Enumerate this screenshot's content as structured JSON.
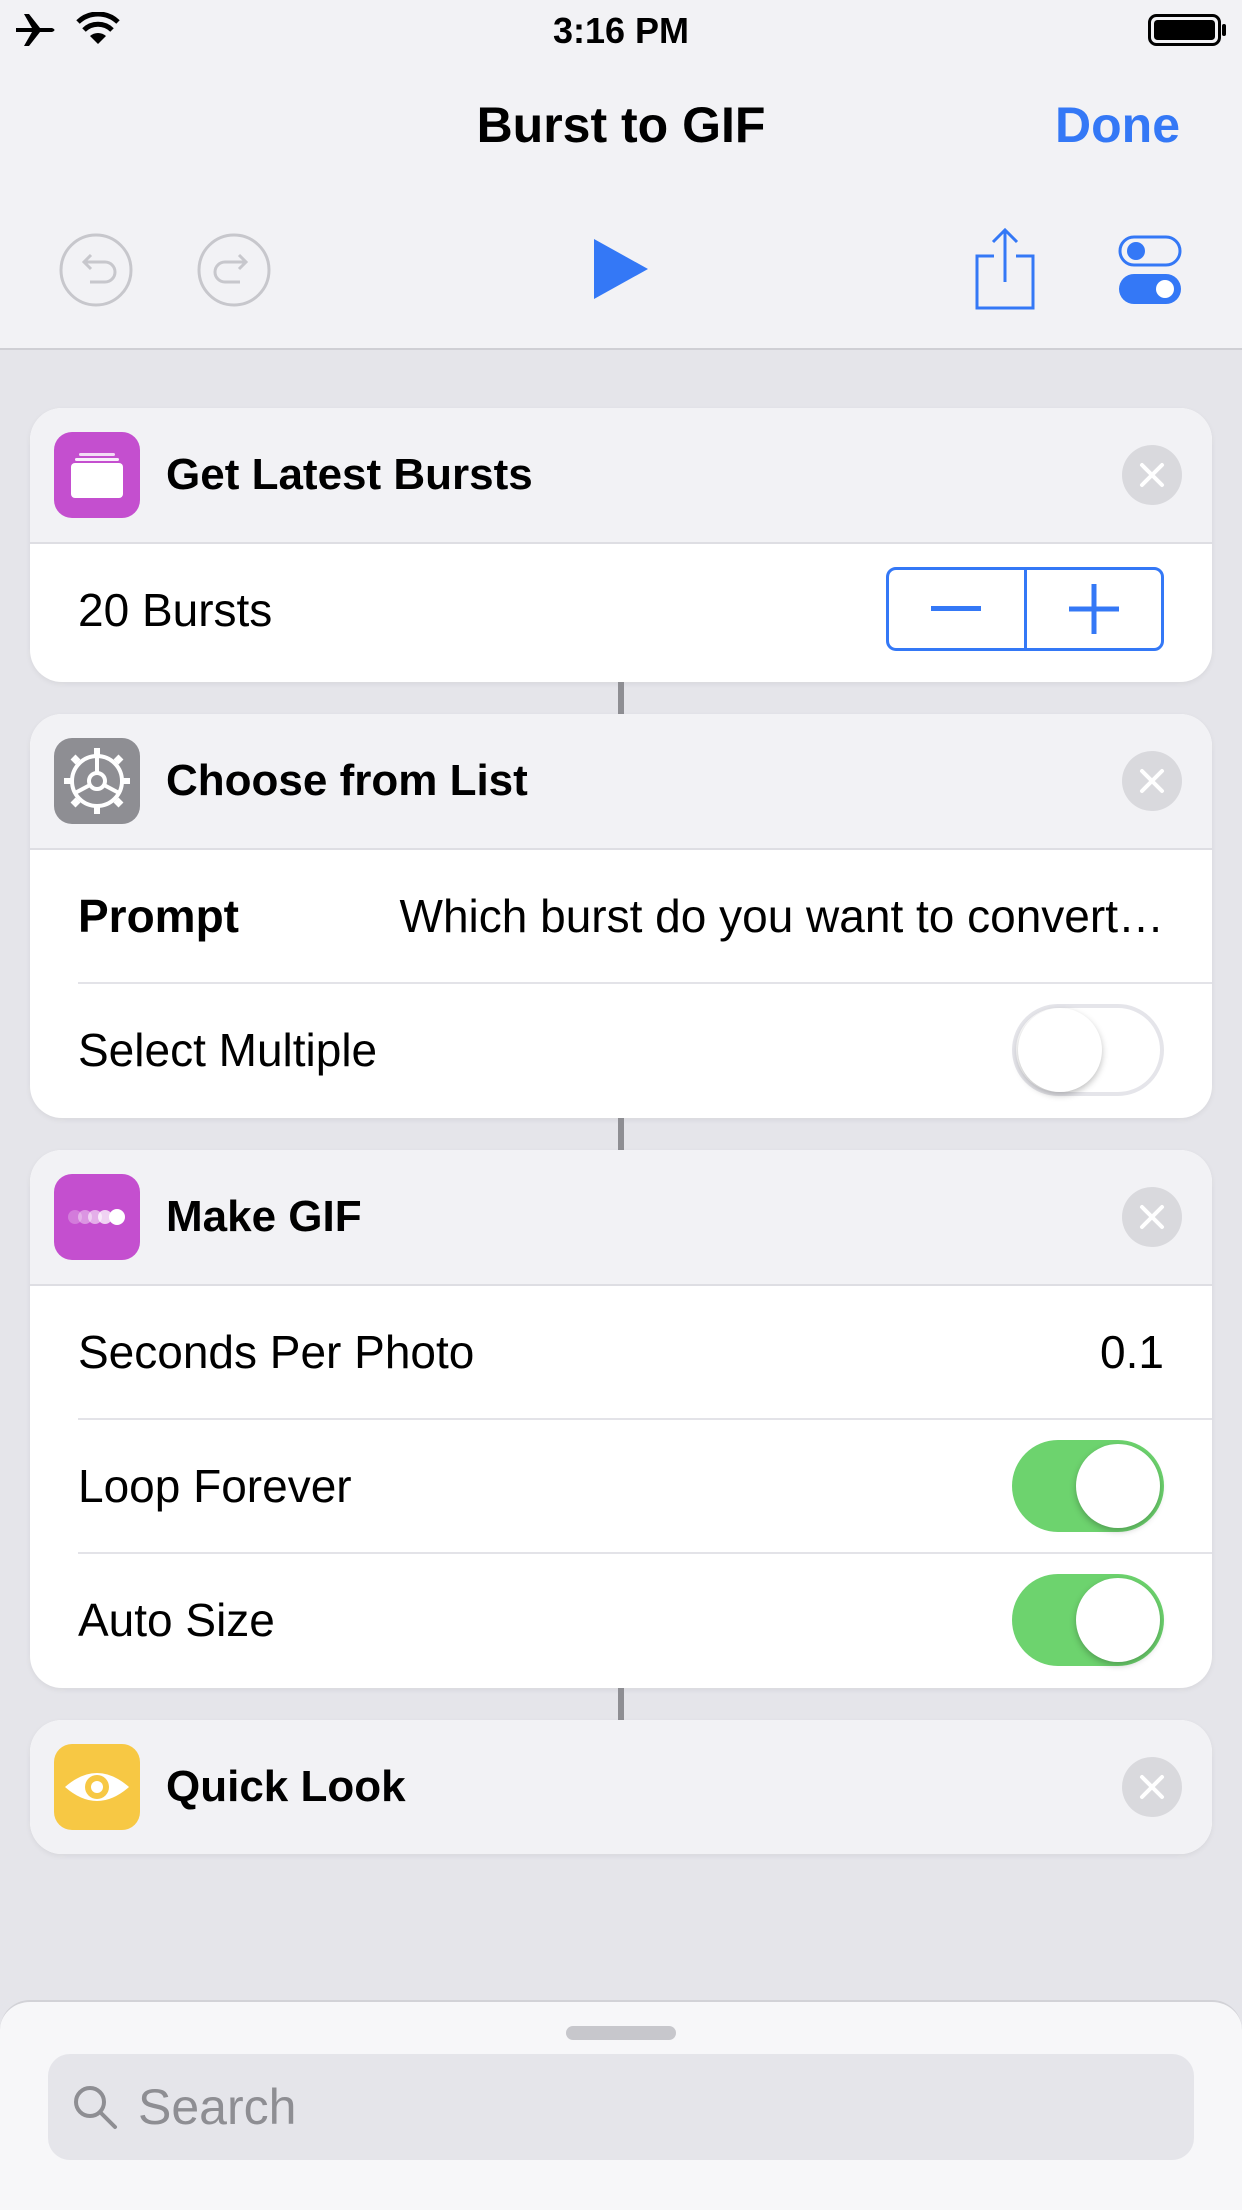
{
  "status_bar": {
    "time": "3:16 PM"
  },
  "nav": {
    "title": "Burst to GIF",
    "done_label": "Done"
  },
  "accent": "#3478f6",
  "actions": [
    {
      "title": "Get Latest Bursts",
      "icon": "photos-stack-icon",
      "icon_color": "#c44fcf",
      "count_label": "20 Bursts"
    },
    {
      "title": "Choose from List",
      "icon": "gear-icon",
      "icon_color": "#8e8e93",
      "prompt_label": "Prompt",
      "prompt_value": "Which burst do you want to convert…",
      "select_multiple_label": "Select Multiple",
      "select_multiple": false
    },
    {
      "title": "Make GIF",
      "icon": "gif-dots-icon",
      "icon_color": "#c44fcf",
      "seconds_label": "Seconds Per Photo",
      "seconds_value": "0.1",
      "loop_label": "Loop Forever",
      "loop": true,
      "autosize_label": "Auto Size",
      "autosize": true
    },
    {
      "title": "Quick Look",
      "icon": "eye-icon",
      "icon_color": "#f7c844"
    }
  ],
  "search": {
    "placeholder": "Search"
  }
}
